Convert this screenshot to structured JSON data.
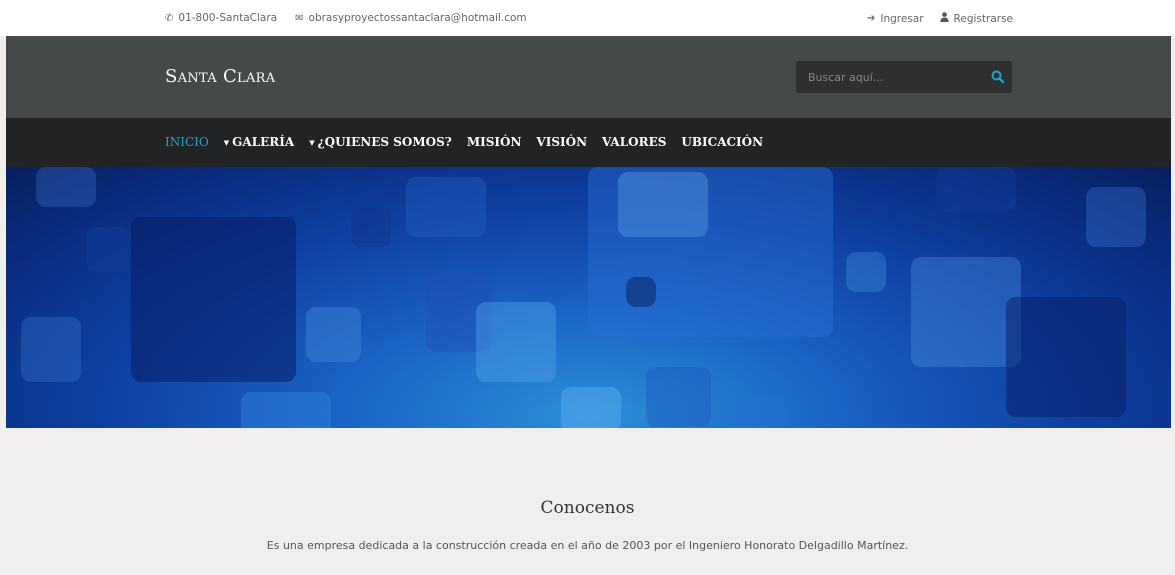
{
  "topbar": {
    "phone": "01-800-SantaClara",
    "email": "obrasyproyectossantaclara@hotmail.com",
    "login": "Ingresar",
    "register": "Registrarse"
  },
  "header": {
    "logo": "Santa Clara",
    "search_placeholder": "Buscar aquí..."
  },
  "nav": {
    "items": [
      {
        "label": "INICIO"
      },
      {
        "label": "GALERÍA"
      },
      {
        "label": "¿QUIENES SOMOS?"
      },
      {
        "label": "MISIÓN"
      },
      {
        "label": "VISIÓN"
      },
      {
        "label": "VALORES"
      },
      {
        "label": "UBICACIÓN"
      }
    ]
  },
  "content": {
    "heading": "Conocenos",
    "text": "Es una empresa dedicada a la construcción creada en el año de 2003 por el Ingeniero Honorato Delgadillo Martínez."
  },
  "colors": {
    "accent": "#1fa3c9",
    "header_bg": "#46494a",
    "nav_bg": "#222324",
    "page_bg": "#f0efed"
  }
}
